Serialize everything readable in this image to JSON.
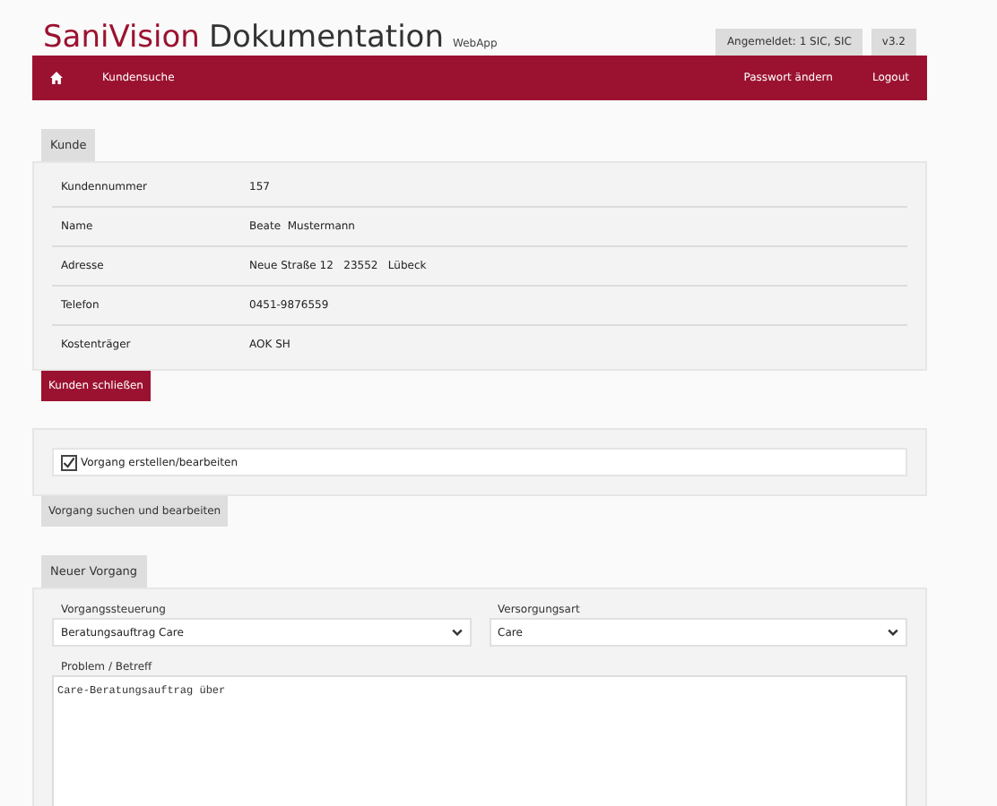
{
  "header": {
    "brand": "SaniVision",
    "title": "Dokumentation",
    "subtitle": "WebApp",
    "user_badge": "Angemeldet: 1  SIC, SIC",
    "version": "v3.2"
  },
  "nav": {
    "left": [
      "Kundensuche"
    ],
    "right": [
      "Passwort ändern",
      "Logout"
    ]
  },
  "customer": {
    "tab": "Kunde",
    "rows": [
      {
        "label": "Kundennummer",
        "value": "157"
      },
      {
        "label": "Name",
        "value": "Beate  Mustermann"
      },
      {
        "label": "Adresse",
        "value": "Neue Straße 12   23552   Lübeck"
      },
      {
        "label": "Telefon",
        "value": "0451-9876559"
      },
      {
        "label": "Kostenträger",
        "value": "AOK SH"
      }
    ],
    "close_button": "Kunden schließen"
  },
  "process": {
    "checkbox": {
      "label": "Vorgang erstellen/bearbeiten",
      "checked": true
    },
    "search_button": "Vorgang suchen und bearbeiten"
  },
  "new_process": {
    "tab": "Neuer Vorgang",
    "selects": [
      {
        "label": "Vorgangssteuerung",
        "value": "Beratungsauftrag Care"
      },
      {
        "label": "Versorgungsart",
        "value": "Care"
      }
    ],
    "textarea": {
      "label": "Problem / Betreff",
      "value": "Care-Beratungsauftrag über"
    }
  }
}
